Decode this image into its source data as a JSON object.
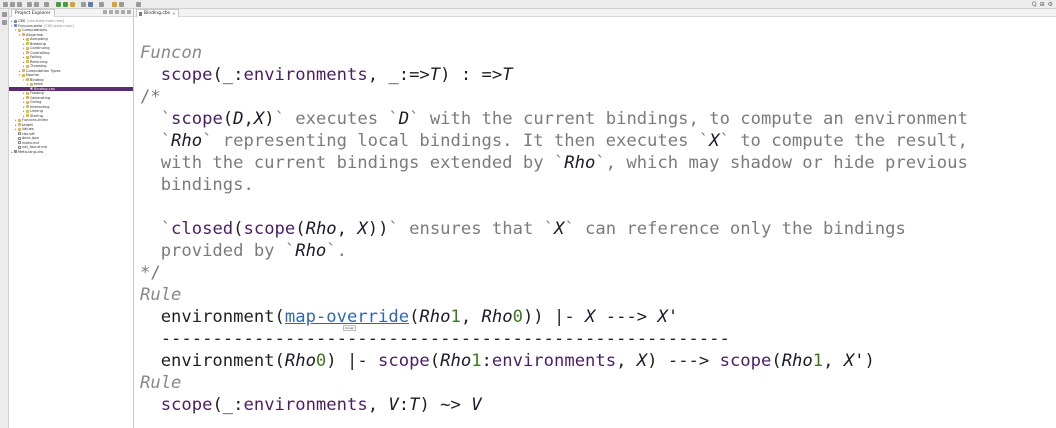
{
  "toolbar": {
    "right_icons": [
      "search-icon",
      "perspective-icon",
      "java-icon"
    ],
    "right_text": [
      "Q",
      "⊞",
      "⚙"
    ]
  },
  "explorer": {
    "tab_label": "Project Explorer",
    "tree": [
      {
        "label": "CBS",
        "sub": "[cbs-beta main.new]",
        "depth": 0,
        "kind": "proj",
        "expanded": false
      },
      {
        "label": "Funcons-beta",
        "sub": "[CBS-beta main]",
        "depth": 0,
        "kind": "proj",
        "expanded": true
      },
      {
        "label": "Computations",
        "sub": "",
        "depth": 1,
        "kind": "folder",
        "expanded": true
      },
      {
        "label": "Abnormal",
        "sub": "",
        "depth": 2,
        "kind": "folder",
        "expanded": true
      },
      {
        "label": "Abrupting",
        "sub": "",
        "depth": 3,
        "kind": "folder",
        "expanded": false
      },
      {
        "label": "Breaking",
        "sub": "",
        "depth": 3,
        "kind": "folder",
        "expanded": false
      },
      {
        "label": "Continuing",
        "sub": "",
        "depth": 3,
        "kind": "folder",
        "expanded": false
      },
      {
        "label": "Controlling",
        "sub": "",
        "depth": 3,
        "kind": "folder",
        "expanded": false
      },
      {
        "label": "Failing",
        "sub": "",
        "depth": 3,
        "kind": "folder",
        "expanded": false
      },
      {
        "label": "Returning",
        "sub": "",
        "depth": 3,
        "kind": "folder",
        "expanded": false
      },
      {
        "label": "Throwing",
        "sub": "",
        "depth": 3,
        "kind": "folder",
        "expanded": false
      },
      {
        "label": "Computation Types",
        "sub": "",
        "depth": 2,
        "kind": "folder",
        "expanded": false
      },
      {
        "label": "Normal",
        "sub": "",
        "depth": 2,
        "kind": "folder",
        "expanded": true
      },
      {
        "label": "Binding",
        "sub": "",
        "depth": 3,
        "kind": "folder",
        "expanded": true
      },
      {
        "label": "tests",
        "sub": "",
        "depth": 4,
        "kind": "folder",
        "expanded": false
      },
      {
        "label": "Binding.cbs",
        "sub": "",
        "depth": 4,
        "kind": "file",
        "expanded": false,
        "selected": true
      },
      {
        "label": "Flowing",
        "sub": "",
        "depth": 3,
        "kind": "folder",
        "expanded": false
      },
      {
        "label": "Generating",
        "sub": "",
        "depth": 3,
        "kind": "folder",
        "expanded": false
      },
      {
        "label": "Giving",
        "sub": "",
        "depth": 3,
        "kind": "folder",
        "expanded": false
      },
      {
        "label": "Interacting",
        "sub": "",
        "depth": 3,
        "kind": "folder",
        "expanded": false
      },
      {
        "label": "Linking",
        "sub": "",
        "depth": 3,
        "kind": "folder",
        "expanded": false
      },
      {
        "label": "Storing",
        "sub": "",
        "depth": 3,
        "kind": "folder",
        "expanded": false
      },
      {
        "label": "Funcons-Index",
        "sub": "",
        "depth": 1,
        "kind": "folder",
        "expanded": false
      },
      {
        "label": "target",
        "sub": "",
        "depth": 1,
        "kind": "folder",
        "expanded": false
      },
      {
        "label": "Values",
        "sub": "",
        "depth": 1,
        "kind": "folder",
        "expanded": false
      },
      {
        "label": "cbs.sdf",
        "sub": "",
        "depth": 1,
        "kind": "file",
        "expanded": false
      },
      {
        "label": "deck.json",
        "sub": "",
        "depth": 1,
        "kind": "file",
        "expanded": false
      },
      {
        "label": "index.md",
        "sub": "",
        "depth": 1,
        "kind": "file",
        "expanded": false
      },
      {
        "label": "not_found.md",
        "sub": "",
        "depth": 1,
        "kind": "file",
        "expanded": false
      },
      {
        "label": "Meta-lang-cbs",
        "sub": "",
        "depth": 0,
        "kind": "proj",
        "expanded": false
      }
    ]
  },
  "editor": {
    "tab_label": "Binding.cbs",
    "tooltip": "hover",
    "lines": [
      [
        {
          "t": "Funcon",
          "c": "kw"
        }
      ],
      [
        {
          "t": "  ",
          "c": ""
        },
        {
          "t": "scope",
          "c": "fn"
        },
        {
          "t": "(_:",
          "c": "kb"
        },
        {
          "t": "environments",
          "c": "ty"
        },
        {
          "t": ", _:=>",
          "c": "kb"
        },
        {
          "t": "T",
          "c": "var"
        },
        {
          "t": ") : =>",
          "c": "kb"
        },
        {
          "t": "T",
          "c": "var"
        }
      ],
      [
        {
          "t": "/*",
          "c": "cm"
        }
      ],
      [
        {
          "t": "  `",
          "c": "bq"
        },
        {
          "t": "scope",
          "c": "fn"
        },
        {
          "t": "(",
          "c": "kb"
        },
        {
          "t": "D",
          "c": "var"
        },
        {
          "t": ",",
          "c": "kb"
        },
        {
          "t": "X",
          "c": "var"
        },
        {
          "t": ")",
          "c": "kb"
        },
        {
          "t": "` executes `",
          "c": "cm"
        },
        {
          "t": "D",
          "c": "var"
        },
        {
          "t": "` with the current bindings, to compute an environment",
          "c": "cm"
        }
      ],
      [
        {
          "t": "  `",
          "c": "bq"
        },
        {
          "t": "Rho",
          "c": "var"
        },
        {
          "t": "` representing local bindings. It then executes `",
          "c": "cm"
        },
        {
          "t": "X",
          "c": "var"
        },
        {
          "t": "` to compute the result,",
          "c": "cm"
        }
      ],
      [
        {
          "t": "  with the current bindings extended by `",
          "c": "cm"
        },
        {
          "t": "Rho",
          "c": "var"
        },
        {
          "t": "`, which may shadow or hide previous",
          "c": "cm"
        }
      ],
      [
        {
          "t": "  bindings.",
          "c": "cm"
        }
      ],
      [
        {
          "t": "",
          "c": ""
        }
      ],
      [
        {
          "t": "  `",
          "c": "bq"
        },
        {
          "t": "closed",
          "c": "fn"
        },
        {
          "t": "(",
          "c": "kb"
        },
        {
          "t": "scope",
          "c": "fn"
        },
        {
          "t": "(",
          "c": "kb"
        },
        {
          "t": "Rho",
          "c": "var"
        },
        {
          "t": ", ",
          "c": "kb"
        },
        {
          "t": "X",
          "c": "var"
        },
        {
          "t": "))",
          "c": "kb"
        },
        {
          "t": "` ensures that `",
          "c": "cm"
        },
        {
          "t": "X",
          "c": "var"
        },
        {
          "t": "` can reference only the bindings",
          "c": "cm"
        }
      ],
      [
        {
          "t": "  provided by `",
          "c": "cm"
        },
        {
          "t": "Rho",
          "c": "var"
        },
        {
          "t": "`.",
          "c": "cm"
        }
      ],
      [
        {
          "t": "*/",
          "c": "cm"
        }
      ],
      [
        {
          "t": "Rule",
          "c": "kw"
        }
      ],
      [
        {
          "t": "  environment(",
          "c": "kb"
        },
        {
          "t": "map-override",
          "c": "lnk"
        },
        {
          "t": "(",
          "c": "kb"
        },
        {
          "t": "Rho",
          "c": "var"
        },
        {
          "t": "1",
          "c": "num"
        },
        {
          "t": ", ",
          "c": "kb"
        },
        {
          "t": "Rho",
          "c": "var"
        },
        {
          "t": "0",
          "c": "num"
        },
        {
          "t": ")) |- ",
          "c": "kb"
        },
        {
          "t": "X",
          "c": "var"
        },
        {
          "t": " ---> ",
          "c": "kb"
        },
        {
          "t": "X'",
          "c": "var"
        }
      ],
      [
        {
          "t": "  -------------------------------------------------------",
          "c": "kb"
        }
      ],
      [
        {
          "t": "  environment(",
          "c": "kb"
        },
        {
          "t": "Rho",
          "c": "var"
        },
        {
          "t": "0",
          "c": "num"
        },
        {
          "t": ") |- ",
          "c": "kb"
        },
        {
          "t": "scope",
          "c": "fn"
        },
        {
          "t": "(",
          "c": "kb"
        },
        {
          "t": "Rho",
          "c": "var"
        },
        {
          "t": "1",
          "c": "num"
        },
        {
          "t": ":",
          "c": "kb"
        },
        {
          "t": "environments",
          "c": "ty"
        },
        {
          "t": ", ",
          "c": "kb"
        },
        {
          "t": "X",
          "c": "var"
        },
        {
          "t": ") ---> ",
          "c": "kb"
        },
        {
          "t": "scope",
          "c": "fn"
        },
        {
          "t": "(",
          "c": "kb"
        },
        {
          "t": "Rho",
          "c": "var"
        },
        {
          "t": "1",
          "c": "num"
        },
        {
          "t": ", ",
          "c": "kb"
        },
        {
          "t": "X'",
          "c": "var"
        },
        {
          "t": ")",
          "c": "kb"
        }
      ],
      [
        {
          "t": "Rule",
          "c": "kw"
        }
      ],
      [
        {
          "t": "  ",
          "c": ""
        },
        {
          "t": "scope",
          "c": "fn"
        },
        {
          "t": "(_:",
          "c": "kb"
        },
        {
          "t": "environments",
          "c": "ty"
        },
        {
          "t": ", ",
          "c": "kb"
        },
        {
          "t": "V",
          "c": "var"
        },
        {
          "t": ":",
          "c": "kb"
        },
        {
          "t": "T",
          "c": "var"
        },
        {
          "t": ") ~> ",
          "c": "kb"
        },
        {
          "t": "V",
          "c": "var"
        }
      ]
    ]
  }
}
